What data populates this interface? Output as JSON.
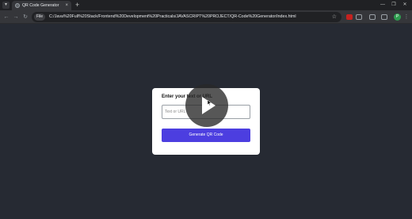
{
  "browser": {
    "tab": {
      "title": "QR Code Generator",
      "close": "×"
    },
    "new_tab": "+",
    "window_controls": {
      "minimize": "—",
      "maximize": "❐",
      "close": "✕"
    },
    "nav": {
      "back": "←",
      "forward": "→",
      "reload": "↻"
    },
    "site_chip": "File",
    "url": "C:/Java%20Full%20Stack/Frontend%20Development%20Practicals/JAVASCRIPT%20PROJECT/QR-Code%20Generator/index.html",
    "star": "☆",
    "profile_initial": "P",
    "colors": {
      "ext_red": "#c5221f",
      "ext_gray": "#9aa0a6",
      "profile": "#2e9d4f"
    }
  },
  "card": {
    "label": "Enter your text or URL",
    "input_placeholder": "Text or URL",
    "input_value": "",
    "button_label": "Generate QR Code",
    "accent": "#4c3ee0"
  },
  "overlay": {
    "icon": "play-icon"
  }
}
